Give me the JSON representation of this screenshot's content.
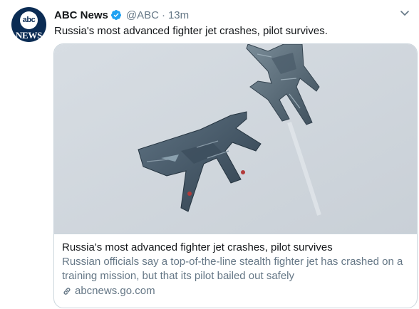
{
  "tweet": {
    "author": {
      "display_name": "ABC News",
      "handle": "@ABC",
      "verified": true,
      "avatar_logo_text": "abc",
      "avatar_wordmark": "NEWS"
    },
    "separator": "·",
    "time_ago": "13m",
    "text": "Russia's most advanced fighter jet crashes, pilot survives."
  },
  "card": {
    "title": "Russia's most advanced fighter jet crashes, pilot survives",
    "description": "Russian officials say a top-of-the-line stealth fighter jet has crashed on a training mission, but that its pilot bailed out safely",
    "domain": "abcnews.go.com",
    "image_subject": "two-stealth-fighter-jets-in-grey-sky"
  },
  "colors": {
    "text_primary": "#14171a",
    "text_secondary": "#657786",
    "verified_blue": "#1da1f2",
    "border": "#ccd6dd",
    "avatar_bg": "#0b2c54"
  },
  "icons": {
    "verified": "verified-badge-icon",
    "menu": "chevron-down-icon",
    "link": "link-icon"
  }
}
